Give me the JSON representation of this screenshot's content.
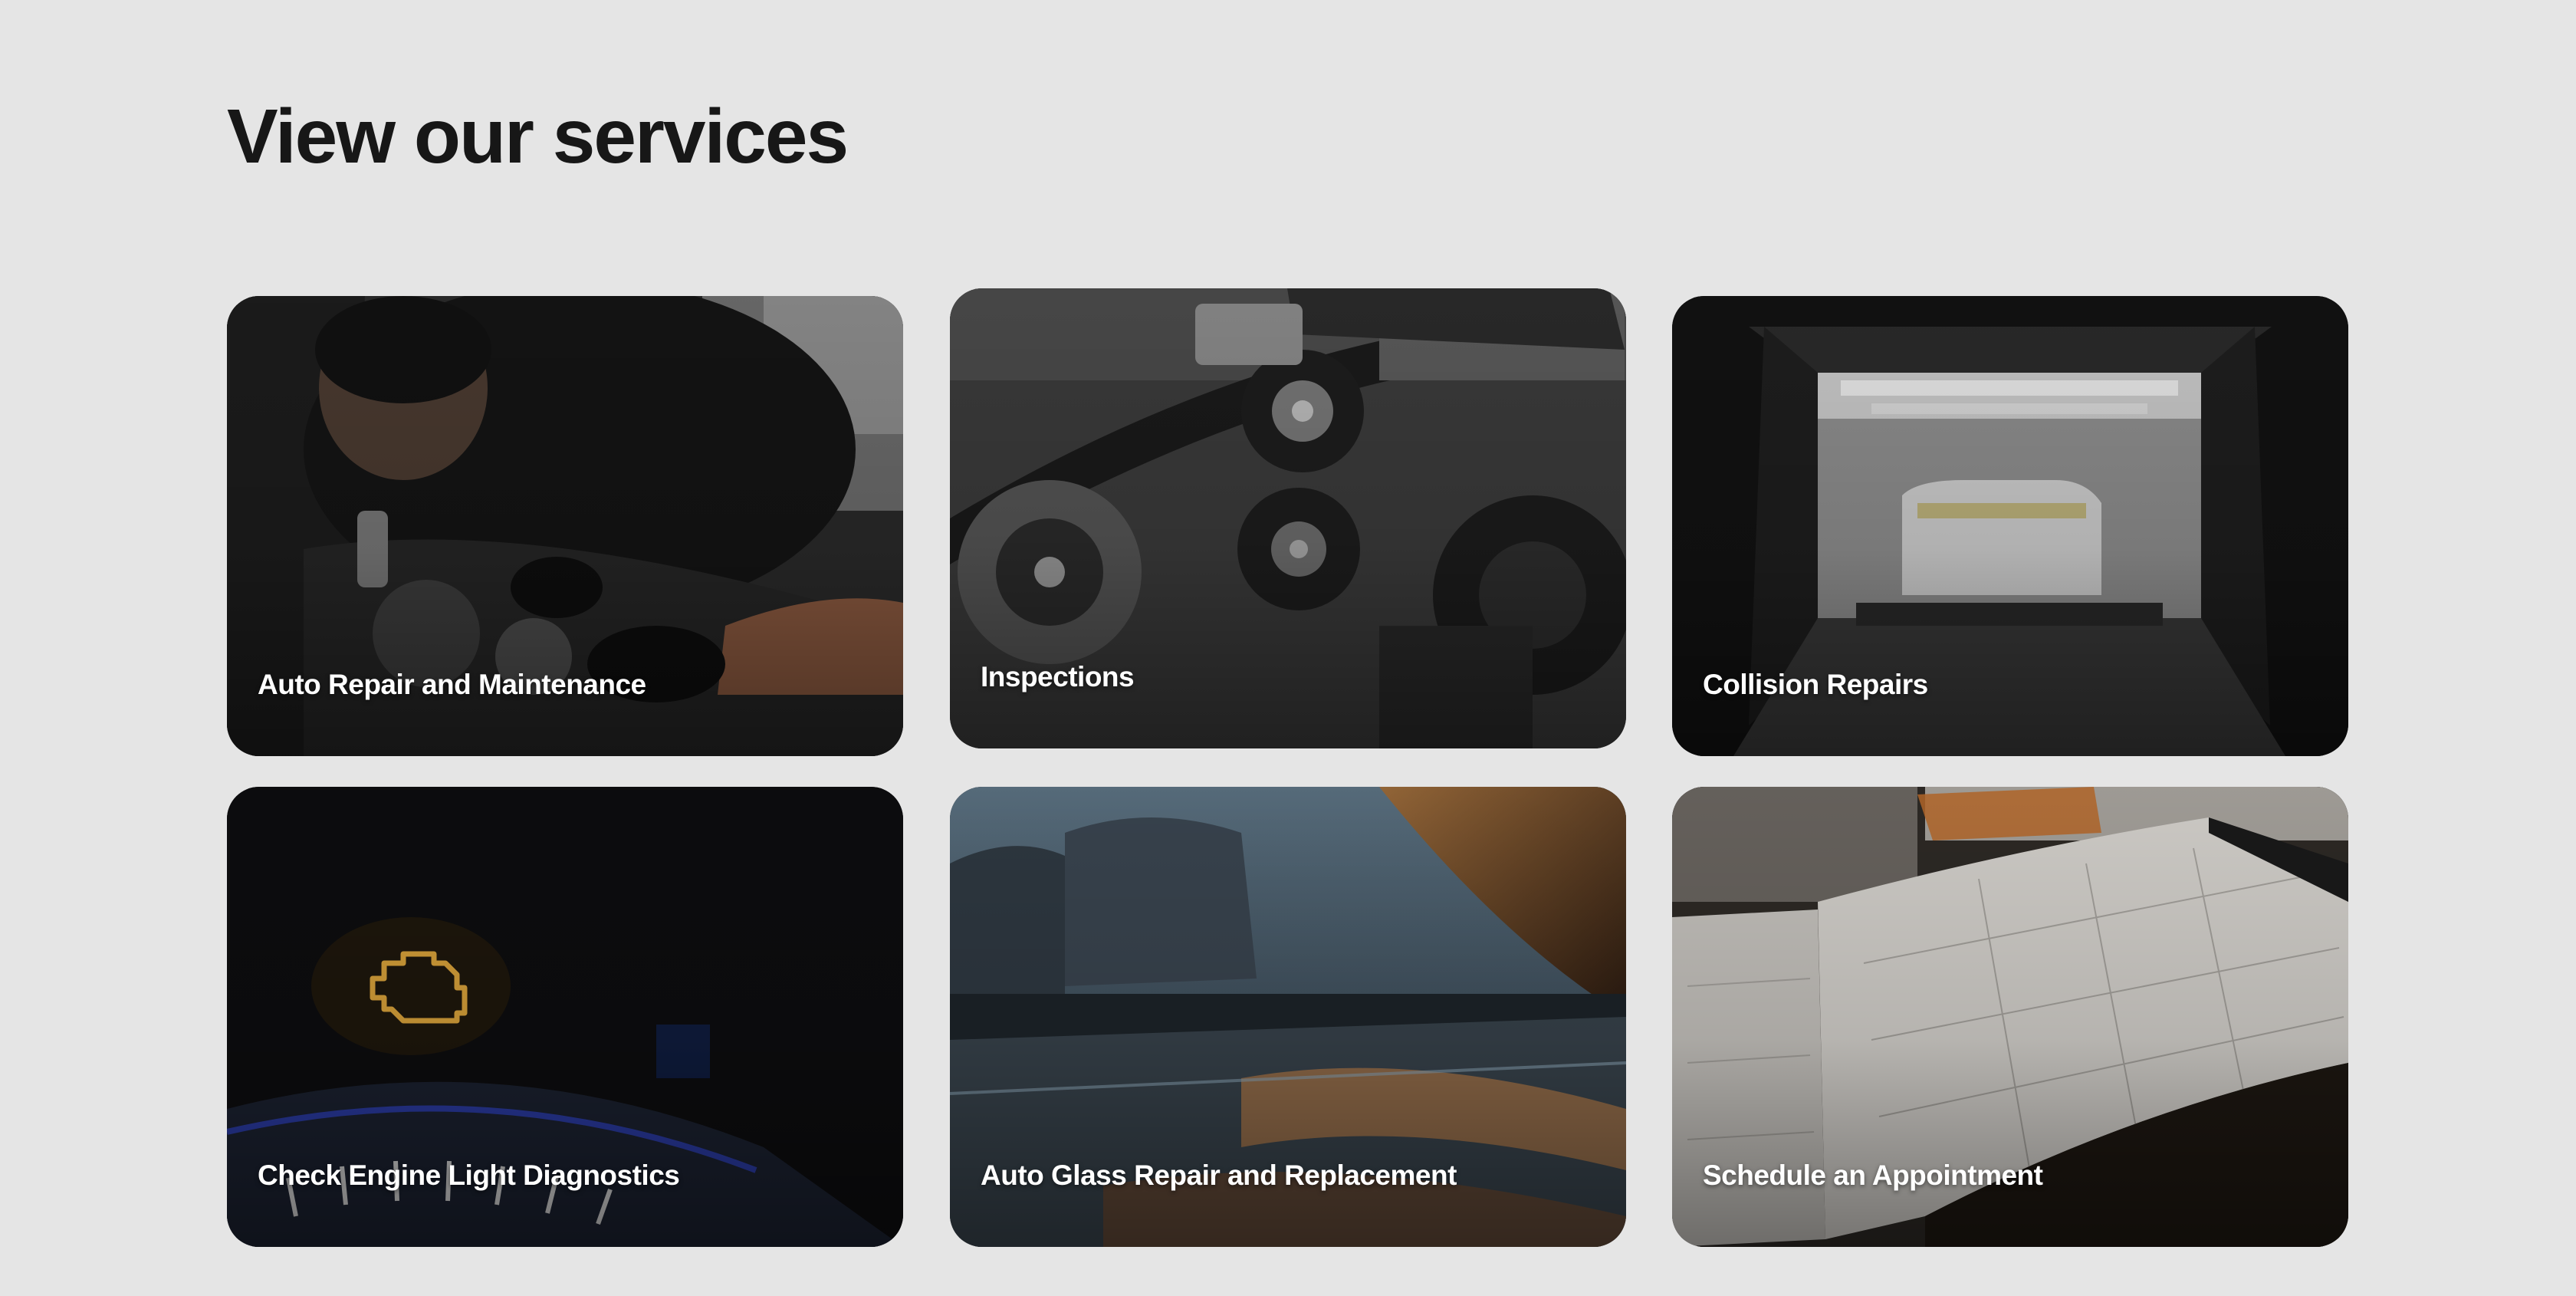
{
  "section": {
    "title": "View our services"
  },
  "services": [
    {
      "label": "Auto Repair and Maintenance",
      "image": "mechanic-working-on-engine"
    },
    {
      "label": "Inspections",
      "image": "engine-belts-and-pulleys"
    },
    {
      "label": "Collision Repairs",
      "image": "car-in-paint-booth"
    },
    {
      "label": "Check Engine Light Diagnostics",
      "image": "check-engine-warning-light"
    },
    {
      "label": "Auto Glass Repair and Replacement",
      "image": "car-window-glass-reflection"
    },
    {
      "label": "Schedule an Appointment",
      "image": "open-calendar-planner"
    }
  ]
}
